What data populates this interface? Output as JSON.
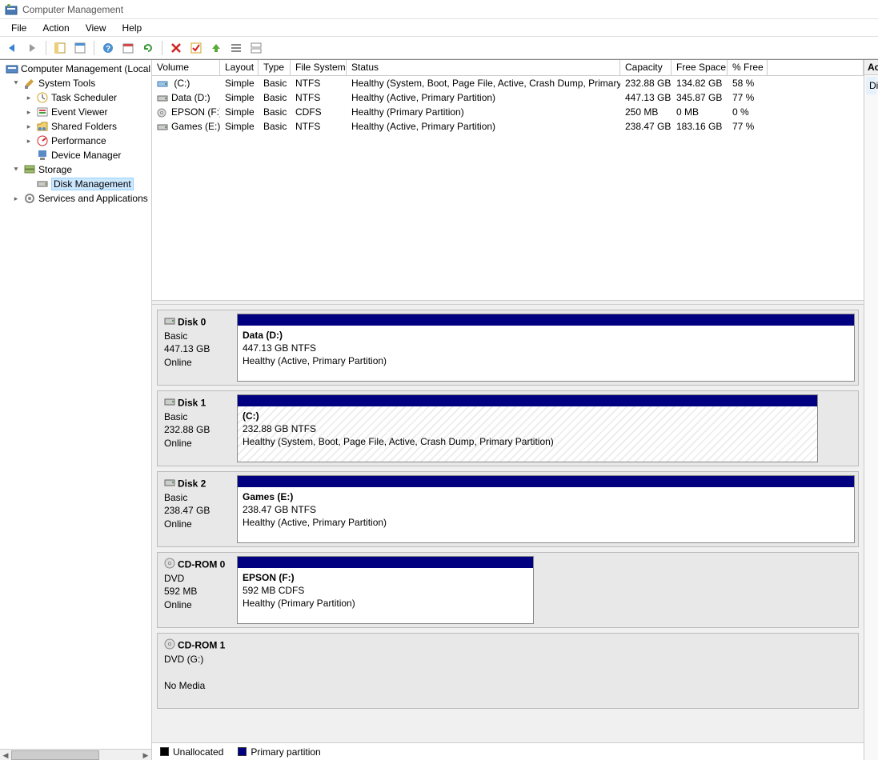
{
  "window": {
    "title": "Computer Management"
  },
  "menu": {
    "file": "File",
    "action": "Action",
    "view": "View",
    "help": "Help"
  },
  "tree": {
    "root": "Computer Management (Local",
    "systools": "System Tools",
    "task": "Task Scheduler",
    "event": "Event Viewer",
    "shared": "Shared Folders",
    "perf": "Performance",
    "devmgr": "Device Manager",
    "storage": "Storage",
    "diskmgmt": "Disk Management",
    "services": "Services and Applications"
  },
  "columns": {
    "volume": "Volume",
    "layout": "Layout",
    "type": "Type",
    "fs": "File System",
    "status": "Status",
    "capacity": "Capacity",
    "free": "Free Space",
    "pct": "% Free"
  },
  "volumes": [
    {
      "name": " (C:)",
      "layout": "Simple",
      "type": "Basic",
      "fs": "NTFS",
      "status": "Healthy (System, Boot, Page File, Active, Crash Dump, Primary Partition)",
      "capacity": "232.88 GB",
      "free": "134.82 GB",
      "pct": "58 %",
      "icon": "hdd-c"
    },
    {
      "name": "Data (D:)",
      "layout": "Simple",
      "type": "Basic",
      "fs": "NTFS",
      "status": "Healthy (Active, Primary Partition)",
      "capacity": "447.13 GB",
      "free": "345.87 GB",
      "pct": "77 %",
      "icon": "hdd"
    },
    {
      "name": "EPSON (F:)",
      "layout": "Simple",
      "type": "Basic",
      "fs": "CDFS",
      "status": "Healthy (Primary Partition)",
      "capacity": "250 MB",
      "free": "0 MB",
      "pct": "0 %",
      "icon": "cd"
    },
    {
      "name": "Games (E:)",
      "layout": "Simple",
      "type": "Basic",
      "fs": "NTFS",
      "status": "Healthy (Active, Primary Partition)",
      "capacity": "238.47 GB",
      "free": "183.16 GB",
      "pct": "77 %",
      "icon": "hdd"
    }
  ],
  "disks": [
    {
      "label": "Disk 0",
      "kind": "Basic",
      "size": "447.13 GB",
      "state": "Online",
      "icon": "hdd",
      "parts": [
        {
          "title": "Data  (D:)",
          "line2": "447.13 GB NTFS",
          "line3": "Healthy (Active, Primary Partition)",
          "hatched": false
        }
      ]
    },
    {
      "label": "Disk 1",
      "kind": "Basic",
      "size": "232.88 GB",
      "state": "Online",
      "icon": "hdd",
      "parts": [
        {
          "title": " (C:)",
          "line2": "232.88 GB NTFS",
          "line3": "Healthy (System, Boot, Page File, Active, Crash Dump, Primary Partition)",
          "hatched": true,
          "short": true
        }
      ]
    },
    {
      "label": "Disk 2",
      "kind": "Basic",
      "size": "238.47 GB",
      "state": "Online",
      "icon": "hdd",
      "parts": [
        {
          "title": "Games  (E:)",
          "line2": "238.47 GB NTFS",
          "line3": "Healthy (Active, Primary Partition)",
          "hatched": false
        }
      ]
    },
    {
      "label": "CD-ROM 0",
      "kind": "DVD",
      "size": "592 MB",
      "state": "Online",
      "icon": "cd",
      "parts": [
        {
          "title": "EPSON  (F:)",
          "line2": "592 MB CDFS",
          "line3": "Healthy (Primary Partition)",
          "hatched": false,
          "half": true
        }
      ]
    },
    {
      "label": "CD-ROM 1",
      "kind": "DVD (G:)",
      "size": "",
      "state": "No Media",
      "icon": "cd",
      "parts": []
    }
  ],
  "legend": {
    "unallocated": "Unallocated",
    "primary": "Primary partition"
  },
  "actions": {
    "header": "Actions",
    "item": "Disk Management"
  }
}
